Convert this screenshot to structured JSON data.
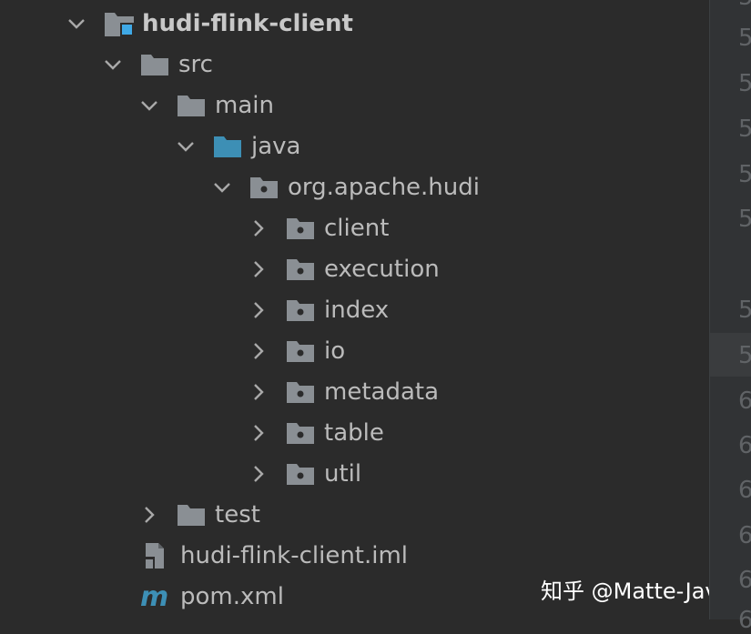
{
  "tree": {
    "module": {
      "label": "hudi-flink-client",
      "expanded": true,
      "icon": "module-folder-icon"
    },
    "src": {
      "label": "src",
      "expanded": true,
      "icon": "folder-icon"
    },
    "main": {
      "label": "main",
      "expanded": true,
      "icon": "folder-icon"
    },
    "java": {
      "label": "java",
      "expanded": true,
      "icon": "source-root-folder-icon"
    },
    "package": {
      "label": "org.apache.hudi",
      "expanded": true,
      "icon": "package-icon"
    },
    "subpackages": [
      {
        "label": "client",
        "expanded": false,
        "icon": "package-icon"
      },
      {
        "label": "execution",
        "expanded": false,
        "icon": "package-icon"
      },
      {
        "label": "index",
        "expanded": false,
        "icon": "package-icon"
      },
      {
        "label": "io",
        "expanded": false,
        "icon": "package-icon"
      },
      {
        "label": "metadata",
        "expanded": false,
        "icon": "package-icon"
      },
      {
        "label": "table",
        "expanded": false,
        "icon": "package-icon"
      },
      {
        "label": "util",
        "expanded": false,
        "icon": "package-icon"
      }
    ],
    "test": {
      "label": "test",
      "expanded": false,
      "icon": "folder-icon"
    },
    "iml_file": {
      "label": "hudi-flink-client.iml",
      "icon": "iml-file-icon"
    },
    "pom_file": {
      "label": "pom.xml",
      "icon": "maven-icon"
    }
  },
  "gutter": {
    "line_numbers": [
      "5",
      "5",
      "5",
      "5",
      "5",
      "5",
      "5",
      "5",
      "6",
      "6",
      "6",
      "6",
      "6",
      "6"
    ]
  },
  "watermark": "知乎 @Matte-Java",
  "colors": {
    "background": "#2b2b2b",
    "text": "#bbbbbb",
    "folder": "#8a8f94",
    "source_root": "#3d8fb5",
    "module_badge": "#3fa9e6"
  }
}
